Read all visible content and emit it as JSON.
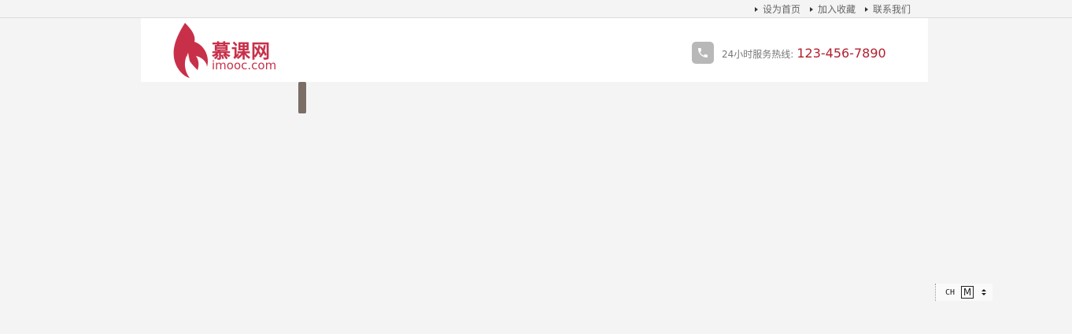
{
  "topbar": {
    "links": [
      {
        "label": "设为首页"
      },
      {
        "label": "加入收藏"
      },
      {
        "label": "联系我们"
      }
    ]
  },
  "header": {
    "logo": {
      "cn": "慕课网",
      "en": "imooc.com"
    },
    "hotline": {
      "label": "24小时服务热线:",
      "number": "123-456-7890"
    }
  },
  "ime": {
    "mode": "CH",
    "layout": "M"
  },
  "colors": {
    "brand": "#c8304a",
    "hotline": "#b21f2d",
    "background": "#f4f4f4",
    "handle": "#7a6e67"
  },
  "icons": {
    "phone": "phone-icon",
    "flame_logo": "flame-logo-icon",
    "link_bullet": "triangle-right-icon"
  }
}
